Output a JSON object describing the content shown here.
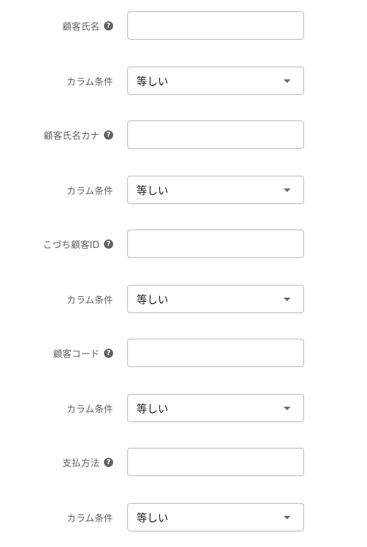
{
  "fields": [
    {
      "label": "顧客氏名",
      "value": "",
      "help_icon": "question-circle-icon"
    },
    {
      "label": "顧客氏名カナ",
      "value": "",
      "help_icon": "question-circle-icon"
    },
    {
      "label": "こづち顧客ID",
      "value": "",
      "help_icon": "question-circle-icon"
    },
    {
      "label": "顧客コード",
      "value": "",
      "help_icon": "question-circle-icon"
    },
    {
      "label": "支払方法",
      "value": "",
      "help_icon": "question-circle-icon"
    }
  ],
  "conditions": [
    {
      "label": "カラム条件",
      "selected": "等しい",
      "icon": "chevron-down-icon"
    },
    {
      "label": "カラム条件",
      "selected": "等しい",
      "icon": "chevron-down-icon"
    },
    {
      "label": "カラム条件",
      "selected": "等しい",
      "icon": "chevron-down-icon"
    },
    {
      "label": "カラム条件",
      "selected": "等しい",
      "icon": "chevron-down-icon"
    },
    {
      "label": "カラム条件",
      "selected": "等しい",
      "icon": "chevron-down-icon"
    }
  ],
  "help_glyph": "?"
}
